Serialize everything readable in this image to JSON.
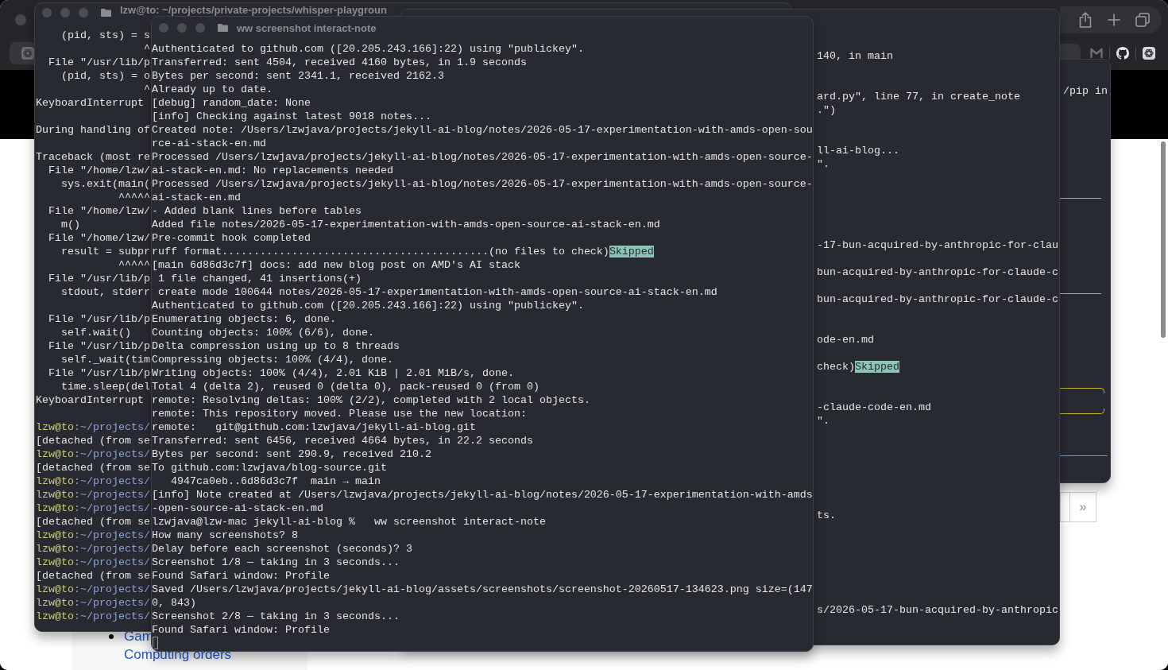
{
  "browser": {
    "sidebar_links": [
      {
        "text": "Gam",
        "bullet": true
      },
      {
        "text": "Computing orders",
        "bullet": false
      }
    ],
    "pagination": [
      {
        "label": "»"
      }
    ]
  },
  "left_terminal": {
    "title": "lzw@to: ~/projects/private-projects/whisper-playgroun",
    "lines": [
      {
        "kind": "text",
        "text": "    (pid, sts) = s"
      },
      {
        "kind": "text",
        "text": "                 ^"
      },
      {
        "kind": "text",
        "text": "  File \"/usr/lib/p"
      },
      {
        "kind": "text",
        "text": "    (pid, sts) = o"
      },
      {
        "kind": "text",
        "text": "                 ^"
      },
      {
        "kind": "text",
        "text": "KeyboardInterrupt"
      },
      {
        "kind": "blank"
      },
      {
        "kind": "text",
        "text": "During handling of"
      },
      {
        "kind": "blank"
      },
      {
        "kind": "text",
        "text": "Traceback (most re"
      },
      {
        "kind": "text",
        "text": "  File \"/home/lzw/"
      },
      {
        "kind": "text",
        "text": "    sys.exit(main("
      },
      {
        "kind": "text",
        "text": "             ^^^^^"
      },
      {
        "kind": "text",
        "text": "  File \"/home/lzw/"
      },
      {
        "kind": "text",
        "text": "    m()"
      },
      {
        "kind": "text",
        "text": "  File \"/home/lzw/"
      },
      {
        "kind": "text",
        "text": "    result = subpr"
      },
      {
        "kind": "text",
        "text": "             ^^^^^"
      },
      {
        "kind": "text",
        "text": "  File \"/usr/lib/p"
      },
      {
        "kind": "text",
        "text": "    stdout, stderr"
      },
      {
        "kind": "blank"
      },
      {
        "kind": "text",
        "text": "  File \"/usr/lib/p"
      },
      {
        "kind": "text",
        "text": "    self.wait()"
      },
      {
        "kind": "text",
        "text": "  File \"/usr/lib/p"
      },
      {
        "kind": "text",
        "text": "    self._wait(tim"
      },
      {
        "kind": "text",
        "text": "  File \"/usr/lib/p"
      },
      {
        "kind": "text",
        "text": "    time.sleep(del"
      },
      {
        "kind": "text",
        "text": "KeyboardInterrupt"
      },
      {
        "kind": "blank"
      },
      {
        "kind": "prompt",
        "user": "lzw@to",
        "path": ":~/projects/"
      },
      {
        "kind": "text",
        "text": "[detached (from se"
      },
      {
        "kind": "prompt",
        "user": "lzw@to",
        "path": ":~/projects/"
      },
      {
        "kind": "text",
        "text": "[detached (from se"
      },
      {
        "kind": "prompt",
        "user": "lzw@to",
        "path": ":~/projects/"
      },
      {
        "kind": "prompt",
        "user": "lzw@to",
        "path": ":~/projects/"
      },
      {
        "kind": "prompt",
        "user": "lzw@to",
        "path": ":~/projects/"
      },
      {
        "kind": "text",
        "text": "[detached (from se"
      },
      {
        "kind": "prompt",
        "user": "lzw@to",
        "path": ":~/projects/"
      },
      {
        "kind": "prompt",
        "user": "lzw@to",
        "path": ":~/projects/"
      },
      {
        "kind": "prompt",
        "user": "lzw@to",
        "path": ":~/projects/"
      },
      {
        "kind": "text",
        "text": "[detached (from se"
      },
      {
        "kind": "prompt",
        "user": "lzw@to",
        "path": ":~/projects/"
      },
      {
        "kind": "prompt",
        "user": "lzw@to",
        "path": ":~/projects/"
      },
      {
        "kind": "prompt",
        "user": "lzw@to",
        "path": ":~/projects/"
      }
    ]
  },
  "right_terminal": {
    "lines": [
      {
        "kind": "text",
        "text": "/pip in"
      }
    ]
  },
  "back_terminal": {
    "lines": [
      {
        "kind": "text",
        "text": "140, in main"
      },
      {
        "kind": "blank"
      },
      {
        "kind": "blank"
      },
      {
        "kind": "text",
        "text": "ard.py\", line 77, in create_note"
      },
      {
        "kind": "text",
        "text": ".\")"
      },
      {
        "kind": "blank"
      },
      {
        "kind": "blank"
      },
      {
        "kind": "text",
        "text": "ll-ai-blog..."
      },
      {
        "kind": "text",
        "text": "\"."
      },
      {
        "kind": "blank"
      },
      {
        "kind": "blank"
      },
      {
        "kind": "blank"
      },
      {
        "kind": "blank"
      },
      {
        "kind": "blank"
      },
      {
        "kind": "text",
        "text": "-17-bun-acquired-by-anthropic-for-clau"
      },
      {
        "kind": "blank"
      },
      {
        "kind": "text",
        "text": "bun-acquired-by-anthropic-for-claude-c"
      },
      {
        "kind": "blank"
      },
      {
        "kind": "text",
        "text": "bun-acquired-by-anthropic-for-claude-c"
      },
      {
        "kind": "blank"
      },
      {
        "kind": "blank"
      },
      {
        "kind": "text",
        "text": "ode-en.md"
      },
      {
        "kind": "blank"
      },
      {
        "kind": "status",
        "text": "check)",
        "tag": "Skipped"
      },
      {
        "kind": "blank"
      },
      {
        "kind": "blank"
      },
      {
        "kind": "text",
        "text": "-claude-code-en.md"
      },
      {
        "kind": "text",
        "text": "\"."
      },
      {
        "kind": "blank"
      },
      {
        "kind": "blank"
      },
      {
        "kind": "blank"
      },
      {
        "kind": "blank"
      },
      {
        "kind": "blank"
      },
      {
        "kind": "blank"
      },
      {
        "kind": "text",
        "text": "ts."
      },
      {
        "kind": "blank"
      },
      {
        "kind": "blank"
      },
      {
        "kind": "blank"
      },
      {
        "kind": "blank"
      },
      {
        "kind": "blank"
      },
      {
        "kind": "blank"
      },
      {
        "kind": "text",
        "text": "s/2026-05-17-bun-acquired-by-anthropic"
      }
    ]
  },
  "front_terminal": {
    "title": "ww screenshot interact-note",
    "cursor": true,
    "lines": [
      {
        "kind": "text",
        "text": "Authenticated to github.com ([20.205.243.166]:22) using \"publickey\"."
      },
      {
        "kind": "text",
        "text": "Transferred: sent 4504, received 4160 bytes, in 1.9 seconds"
      },
      {
        "kind": "text",
        "text": "Bytes per second: sent 2341.1, received 2162.3"
      },
      {
        "kind": "text",
        "text": "Already up to date."
      },
      {
        "kind": "text",
        "text": "[debug] random_date: None"
      },
      {
        "kind": "text",
        "text": "[info] Checking against latest 9018 notes..."
      },
      {
        "kind": "text",
        "text": "Created note: /Users/lzwjava/projects/jekyll-ai-blog/notes/2026-05-17-experimentation-with-amds-open-sou"
      },
      {
        "kind": "text",
        "text": "rce-ai-stack-en.md"
      },
      {
        "kind": "text",
        "text": "Processed /Users/lzwjava/projects/jekyll-ai-blog/notes/2026-05-17-experimentation-with-amds-open-source-"
      },
      {
        "kind": "text",
        "text": "ai-stack-en.md: No replacements needed"
      },
      {
        "kind": "text",
        "text": "Processed /Users/lzwjava/projects/jekyll-ai-blog/notes/2026-05-17-experimentation-with-amds-open-source-"
      },
      {
        "kind": "text",
        "text": "ai-stack-en.md"
      },
      {
        "kind": "text",
        "text": "- Added blank lines before tables"
      },
      {
        "kind": "text",
        "text": "Added file notes/2026-05-17-experimentation-with-amds-open-source-ai-stack-en.md"
      },
      {
        "kind": "text",
        "text": "Pre-commit hook completed"
      },
      {
        "kind": "status",
        "text": "ruff format..........................................(no files to check)",
        "tag": "Skipped"
      },
      {
        "kind": "text",
        "text": "[main 6d86d3c7f] docs: add new blog post on AMD's AI stack"
      },
      {
        "kind": "text",
        "text": " 1 file changed, 41 insertions(+)"
      },
      {
        "kind": "text",
        "text": " create mode 100644 notes/2026-05-17-experimentation-with-amds-open-source-ai-stack-en.md"
      },
      {
        "kind": "text",
        "text": "Authenticated to github.com ([20.205.243.166]:22) using \"publickey\"."
      },
      {
        "kind": "text",
        "text": "Enumerating objects: 6, done."
      },
      {
        "kind": "text",
        "text": "Counting objects: 100% (6/6), done."
      },
      {
        "kind": "text",
        "text": "Delta compression using up to 8 threads"
      },
      {
        "kind": "text",
        "text": "Compressing objects: 100% (4/4), done."
      },
      {
        "kind": "text",
        "text": "Writing objects: 100% (4/4), 2.01 KiB | 2.01 MiB/s, done."
      },
      {
        "kind": "text",
        "text": "Total 4 (delta 2), reused 0 (delta 0), pack-reused 0 (from 0)"
      },
      {
        "kind": "text",
        "text": "remote: Resolving deltas: 100% (2/2), completed with 2 local objects."
      },
      {
        "kind": "text",
        "text": "remote: This repository moved. Please use the new location:"
      },
      {
        "kind": "text",
        "text": "remote:   git@github.com:lzwjava/jekyll-ai-blog.git"
      },
      {
        "kind": "text",
        "text": "Transferred: sent 6456, received 4664 bytes, in 22.2 seconds"
      },
      {
        "kind": "text",
        "text": "Bytes per second: sent 290.9, received 210.2"
      },
      {
        "kind": "text",
        "text": "To github.com:lzwjava/blog-source.git"
      },
      {
        "kind": "text",
        "text": "   4947ca0eb..6d86d3c7f  main → main"
      },
      {
        "kind": "text",
        "text": "[info] Note created at /Users/lzwjava/projects/jekyll-ai-blog/notes/2026-05-17-experimentation-with-amds"
      },
      {
        "kind": "text",
        "text": "-open-source-ai-stack-en.md"
      },
      {
        "kind": "text",
        "text": "lzwjava@lzw-mac jekyll-ai-blog %   ww screenshot interact-note"
      },
      {
        "kind": "text",
        "text": "How many screenshots? 8"
      },
      {
        "kind": "text",
        "text": "Delay before each screenshot (seconds)? 3"
      },
      {
        "kind": "text",
        "text": "Screenshot 1/8 — taking in 3 seconds..."
      },
      {
        "kind": "text",
        "text": "Found Safari window: Profile"
      },
      {
        "kind": "text",
        "text": "Saved /Users/lzwjava/projects/jekyll-ai-blog/assets/screenshots/screenshot-20260517-134623.png size=(147"
      },
      {
        "kind": "text",
        "text": "0, 843)"
      },
      {
        "kind": "text",
        "text": "Screenshot 2/8 — taking in 3 seconds..."
      },
      {
        "kind": "text",
        "text": "Found Safari window: Profile"
      }
    ]
  }
}
